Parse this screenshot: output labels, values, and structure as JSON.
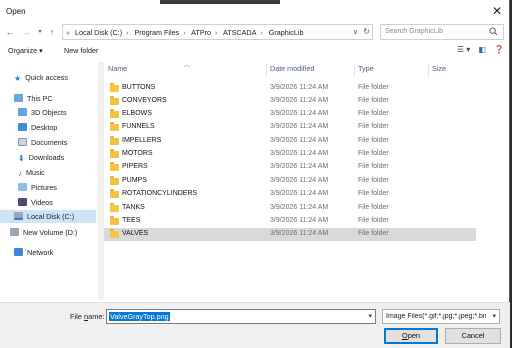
{
  "window": {
    "title": "Open"
  },
  "address": {
    "crumbs": [
      "Local Disk (C:)",
      "Program Files",
      "ATPro",
      "ATSCADA",
      "GraphicLib"
    ]
  },
  "search": {
    "placeholder": "Search GraphicLib"
  },
  "toolbar": {
    "organize": "Organize ▾",
    "new_folder": "New folder"
  },
  "nav": {
    "items": [
      {
        "label": "Quick access",
        "icon": "star-icon"
      },
      {
        "label": "This PC",
        "icon": "pc-icon"
      },
      {
        "label": "3D Objects",
        "icon": "cube-icon"
      },
      {
        "label": "Desktop",
        "icon": "desktop-icon"
      },
      {
        "label": "Documents",
        "icon": "documents-icon"
      },
      {
        "label": "Downloads",
        "icon": "download-icon"
      },
      {
        "label": "Music",
        "icon": "music-icon"
      },
      {
        "label": "Pictures",
        "icon": "pictures-icon"
      },
      {
        "label": "Videos",
        "icon": "videos-icon"
      },
      {
        "label": "Local Disk (C:)",
        "icon": "disk-icon"
      },
      {
        "label": "New Volume (D:)",
        "icon": "disk-icon"
      },
      {
        "label": "Network",
        "icon": "network-icon"
      }
    ]
  },
  "columns": {
    "name": "Name",
    "date": "Date modified",
    "type": "Type",
    "size": "Size"
  },
  "files": [
    {
      "name": "BUTTONS",
      "date": "3/9/2026 11:24 AM",
      "type": "File folder"
    },
    {
      "name": "CONVEYORS",
      "date": "3/9/2026 11:24 AM",
      "type": "File folder"
    },
    {
      "name": "ELBOWS",
      "date": "3/9/2026 11:24 AM",
      "type": "File folder"
    },
    {
      "name": "FUNNELS",
      "date": "3/9/2026 11:24 AM",
      "type": "File folder"
    },
    {
      "name": "IMPELLERS",
      "date": "3/9/2026 11:24 AM",
      "type": "File folder"
    },
    {
      "name": "MOTORS",
      "date": "3/9/2026 11:24 AM",
      "type": "File folder"
    },
    {
      "name": "PIPERS",
      "date": "3/9/2026 11:24 AM",
      "type": "File folder"
    },
    {
      "name": "PUMPS",
      "date": "3/9/2026 11:24 AM",
      "type": "File folder"
    },
    {
      "name": "ROTATIONCYLINDERS",
      "date": "3/9/2026 11:24 AM",
      "type": "File folder"
    },
    {
      "name": "TANKS",
      "date": "3/9/2026 11:24 AM",
      "type": "File folder"
    },
    {
      "name": "TEES",
      "date": "3/9/2026 11:24 AM",
      "type": "File folder"
    },
    {
      "name": "VALVES",
      "date": "3/9/2026 11:24 AM",
      "type": "File folder"
    }
  ],
  "bottom": {
    "file_name_label_prefix": "File ",
    "file_name_label_underlined": "n",
    "file_name_label_suffix": "ame:",
    "file_name_value": "ValveGrayTop.png",
    "filter_value": "Image Files(*.gif;*.jpg;*.jpeg;*.bmp;*.png)",
    "open_underlined": "O",
    "open_rest": "pen",
    "cancel": "Cancel"
  },
  "colors": {
    "accent": "#0078d7",
    "folder": "#f5c542",
    "selected_row": "#d9d9d9",
    "selected_nav": "#cce4f7"
  }
}
